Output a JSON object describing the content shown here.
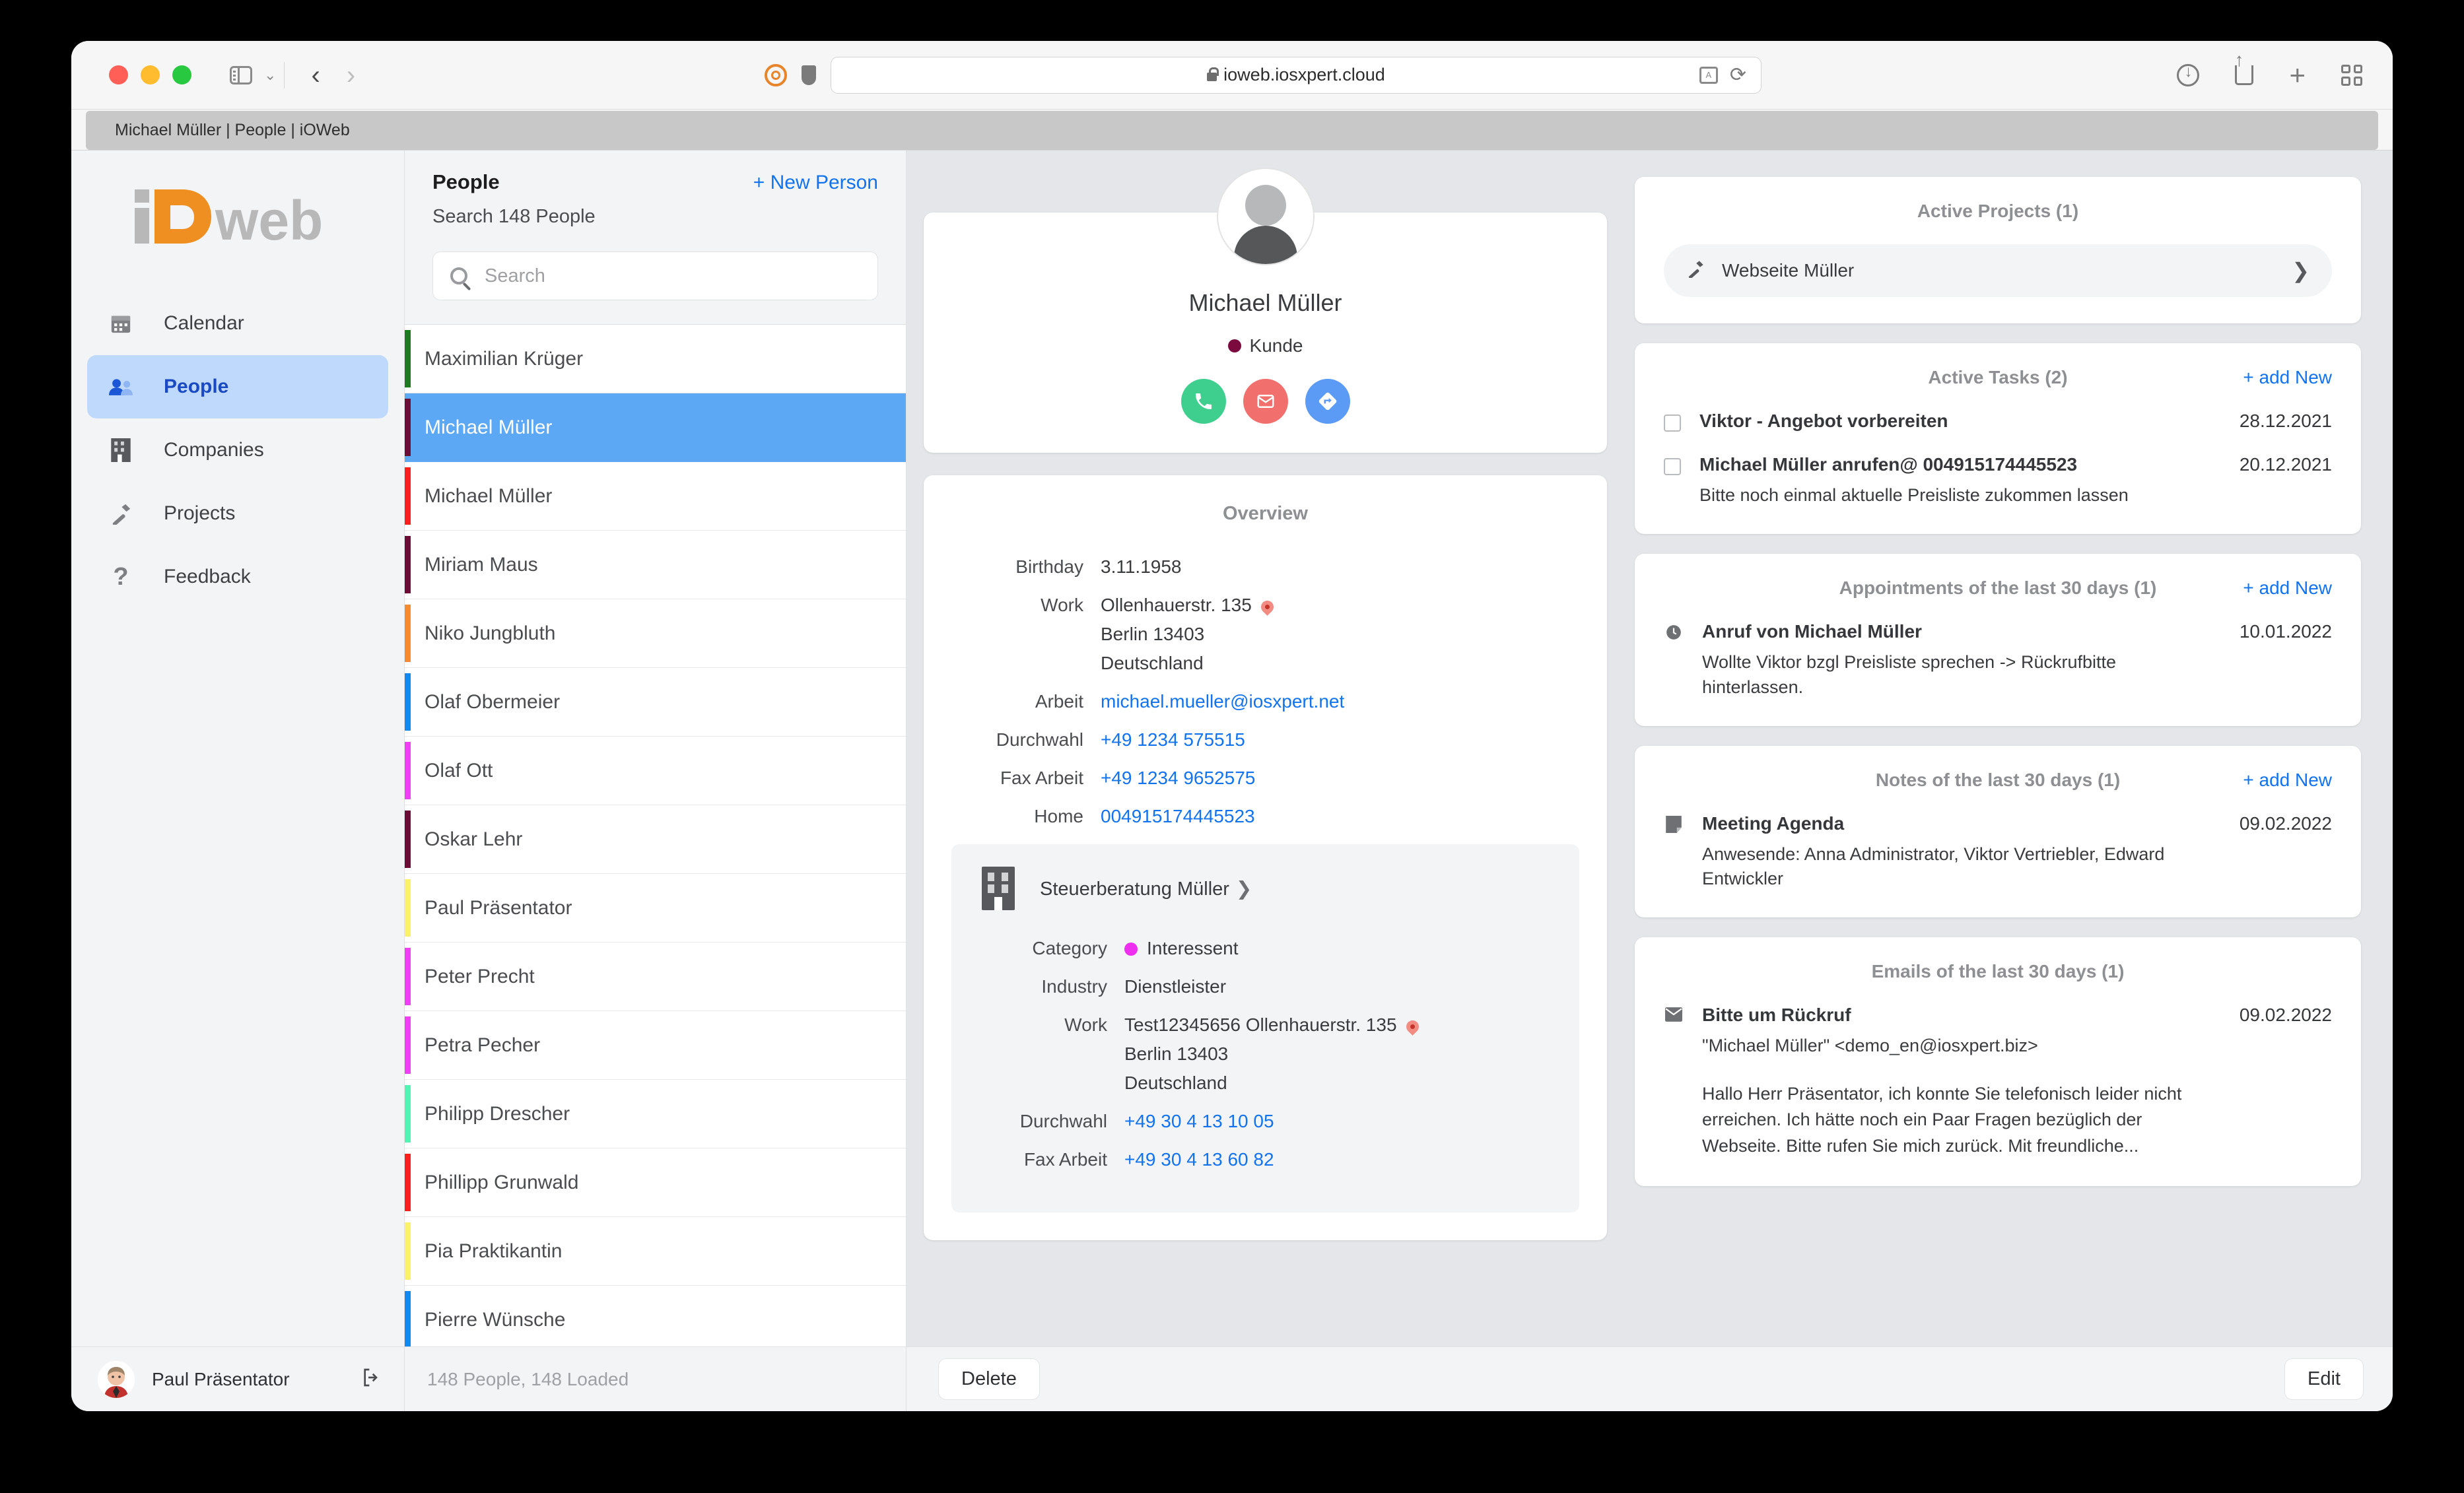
{
  "browser": {
    "tab_title": "Michael Müller | People | iOWeb",
    "url": "ioweb.iosxpert.cloud"
  },
  "sidebar": {
    "logo_text": "ioweb",
    "items": [
      {
        "label": "Calendar",
        "icon": "calendar-icon",
        "active": false
      },
      {
        "label": "People",
        "icon": "people-icon",
        "active": true
      },
      {
        "label": "Companies",
        "icon": "building-icon",
        "active": false
      },
      {
        "label": "Projects",
        "icon": "hammer-icon",
        "active": false
      },
      {
        "label": "Feedback",
        "icon": "question-icon",
        "active": false
      }
    ]
  },
  "list_panel": {
    "title": "People",
    "new_person_label": "+ New Person",
    "subtitle": "Search 148 People",
    "search_placeholder": "Search",
    "items": [
      {
        "name": "Maximilian Krüger",
        "color": "#1f7a1f",
        "selected": false
      },
      {
        "name": "Michael Müller",
        "color": "#6b0d37",
        "selected": true
      },
      {
        "name": "Michael Müller",
        "color": "#fa2020",
        "selected": false
      },
      {
        "name": "Miriam Maus",
        "color": "#6b0d37",
        "selected": false
      },
      {
        "name": "Niko Jungbluth",
        "color": "#f58a2e",
        "selected": false
      },
      {
        "name": "Olaf Obermeier",
        "color": "#1189f5",
        "selected": false
      },
      {
        "name": "Olaf Ott",
        "color": "#f23ff5",
        "selected": false
      },
      {
        "name": "Oskar Lehr",
        "color": "#6b0d37",
        "selected": false
      },
      {
        "name": "Paul Präsentator",
        "color": "#faf268",
        "selected": false
      },
      {
        "name": "Peter Precht",
        "color": "#f23ff5",
        "selected": false
      },
      {
        "name": "Petra Pecher",
        "color": "#f23ff5",
        "selected": false
      },
      {
        "name": "Philipp Drescher",
        "color": "#4ef5b4",
        "selected": false
      },
      {
        "name": "Phillipp Grunwald",
        "color": "#fa2020",
        "selected": false
      },
      {
        "name": "Pia Praktikantin",
        "color": "#faf268",
        "selected": false
      },
      {
        "name": "Pierre Wünsche",
        "color": "#1189f5",
        "selected": false
      }
    ]
  },
  "person": {
    "name": "Michael Müller",
    "category_label": "Kunde",
    "category_color": "#7b0b3e",
    "actions": [
      {
        "name": "call-button",
        "icon": "phone-icon",
        "color": "#3ecf8e"
      },
      {
        "name": "email-button",
        "icon": "envelope-icon",
        "color": "#f1706e"
      },
      {
        "name": "route-button",
        "icon": "directions-icon",
        "color": "#5c9bf5"
      }
    ],
    "overview_title": "Overview",
    "fields": [
      {
        "label": "Birthday",
        "value": "3.11.1958",
        "type": "text"
      },
      {
        "label": "Work",
        "value": "Ollenhauerstr. 135",
        "type": "address",
        "line2": "Berlin 13403",
        "line3": "Deutschland"
      },
      {
        "label": "Arbeit",
        "value": "michael.mueller@iosxpert.net",
        "type": "link"
      },
      {
        "label": "Durchwahl",
        "value": "+49 1234 575515",
        "type": "link"
      },
      {
        "label": "Fax Arbeit",
        "value": "+49 1234 9652575",
        "type": "link"
      },
      {
        "label": "Home",
        "value": "004915174445523",
        "type": "link"
      }
    ],
    "company": {
      "name": "Steuerberatung Müller",
      "fields": [
        {
          "label": "Category",
          "value": "Interessent",
          "type": "dot",
          "dot_color": "#ef2ff0"
        },
        {
          "label": "Industry",
          "value": "Dienstleister",
          "type": "text"
        },
        {
          "label": "Work",
          "value": "Test12345656 Ollenhauerstr. 135",
          "type": "address",
          "line2": "Berlin 13403",
          "line3": "Deutschland"
        },
        {
          "label": "Durchwahl",
          "value": "+49 30 4 13 10 05",
          "type": "link"
        },
        {
          "label": "Fax Arbeit",
          "value": "+49 30 4 13 60 82",
          "type": "link"
        }
      ]
    }
  },
  "panels": {
    "projects": {
      "title": "Active Projects (1)",
      "items": [
        {
          "title": "Webseite Müller",
          "icon": "hammer-icon"
        }
      ]
    },
    "tasks": {
      "title": "Active Tasks (2)",
      "add_label": "+ add New",
      "items": [
        {
          "title": "Viktor - Angebot vorbereiten",
          "date": "28.12.2021",
          "desc": ""
        },
        {
          "title": "Michael Müller anrufen@ 004915174445523",
          "date": "20.12.2021",
          "desc": "Bitte noch einmal aktuelle Preisliste zukommen lassen"
        }
      ]
    },
    "appointments": {
      "title": "Appointments of the last 30 days (1)",
      "add_label": "+ add New",
      "items": [
        {
          "title": "Anruf von Michael Müller",
          "date": "10.01.2022",
          "desc": "Wollte Viktor bzgl Preisliste sprechen -> Rückrufbitte hinterlassen.",
          "icon": "clock-icon"
        }
      ]
    },
    "notes": {
      "title": "Notes of the last 30 days (1)",
      "add_label": "+ add New",
      "items": [
        {
          "title": "Meeting Agenda",
          "date": "09.02.2022",
          "desc": "Anwesende: Anna Administrator, Viktor Vertriebler, Edward Entwickler",
          "icon": "note-icon"
        }
      ]
    },
    "emails": {
      "title": "Emails of the last 30 days (1)",
      "items": [
        {
          "title": "Bitte um Rückruf",
          "date": "09.02.2022",
          "desc": "\"Michael Müller\" <demo_en@iosxpert.biz>",
          "icon": "envelope-icon",
          "body": "Hallo Herr Präsentator, ich konnte Sie telefonisch leider nicht erreichen. Ich hätte noch ein Paar Fragen bezüglich der Webseite. Bitte rufen Sie mich zurück. Mit freundliche..."
        }
      ]
    }
  },
  "bottom_bar": {
    "user_name": "Paul Präsentator",
    "status": "148 People, 148 Loaded",
    "delete_label": "Delete",
    "edit_label": "Edit"
  }
}
